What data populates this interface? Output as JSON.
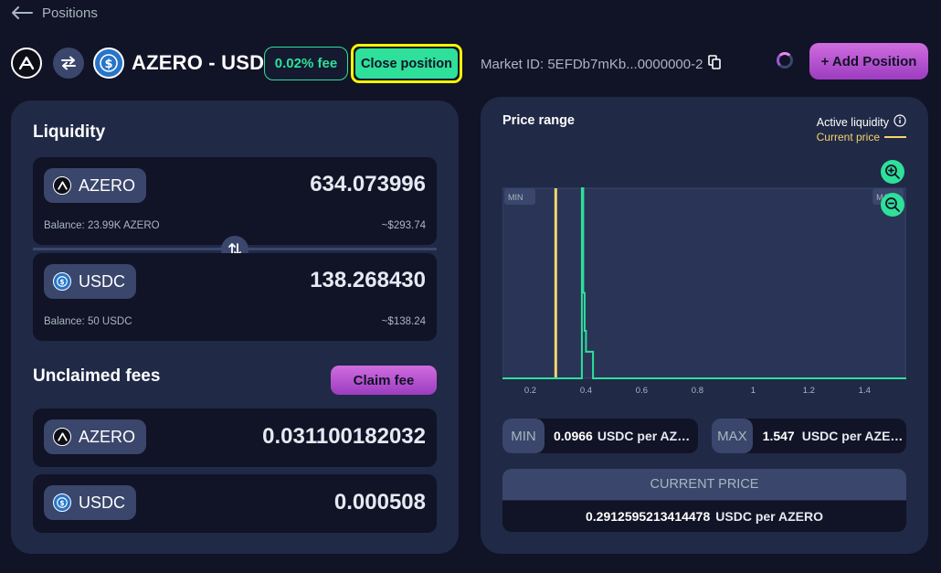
{
  "nav": {
    "back_label": "Positions"
  },
  "header": {
    "token_a": "AZERO",
    "token_b": "USDC",
    "pair_title": "AZERO - USDC",
    "fee_badge": "0.02% fee",
    "close_position_label": "Close position",
    "market_id": "Market ID: 5EFDb7mKb...0000000-2",
    "add_position_label": "+ Add Position"
  },
  "liquidity": {
    "title": "Liquidity",
    "tokens": [
      {
        "symbol": "AZERO",
        "amount": "634.073996",
        "balance": "Balance: 23.99K AZERO",
        "usd": "~$293.74"
      },
      {
        "symbol": "USDC",
        "amount": "138.268430",
        "balance": "Balance: 50 USDC",
        "usd": "~$138.24"
      }
    ]
  },
  "unclaimed": {
    "title": "Unclaimed fees",
    "claim_label": "Claim fee",
    "tokens": [
      {
        "symbol": "AZERO",
        "amount": "0.031100182032"
      },
      {
        "symbol": "USDC",
        "amount": "0.000508"
      }
    ]
  },
  "price_range": {
    "title": "Price range",
    "active_liquidity_label": "Active liquidity",
    "current_price_legend": "Current price",
    "min_tag": "MIN",
    "max_tag": "MAX",
    "min_label": "MIN",
    "min_value": "0.0966",
    "min_unit": "USDC per AZERO",
    "max_label": "MAX",
    "max_value": "1.547",
    "max_unit": "USDC per AZERO",
    "current_price_label": "CURRENT PRICE",
    "current_price_value": "0.2912595213414478",
    "current_price_unit": "USDC per AZERO"
  },
  "colors": {
    "accent_green": "#2ee09a",
    "current_price_yellow": "#f6d36e",
    "purple": "#c55cd9",
    "panel": "#202946",
    "background": "#111326"
  },
  "chart_data": {
    "type": "line",
    "x_ticks": [
      "0.2",
      "0.4",
      "0.6",
      "0.8",
      "1",
      "1.2",
      "1.4"
    ],
    "xlim": [
      0.1,
      1.55
    ],
    "current_price": 0.2913,
    "range_min": 0.0966,
    "range_max": 1.547,
    "liquidity_series": {
      "name": "Active liquidity",
      "x": [
        0.1,
        0.385,
        0.385,
        0.39,
        0.39,
        0.395,
        0.395,
        0.4,
        0.4,
        0.425,
        0.425,
        1.55
      ],
      "y": [
        0,
        0,
        1.0,
        1.0,
        0.45,
        0.45,
        0.25,
        0.25,
        0.14,
        0.14,
        0,
        0
      ]
    }
  }
}
